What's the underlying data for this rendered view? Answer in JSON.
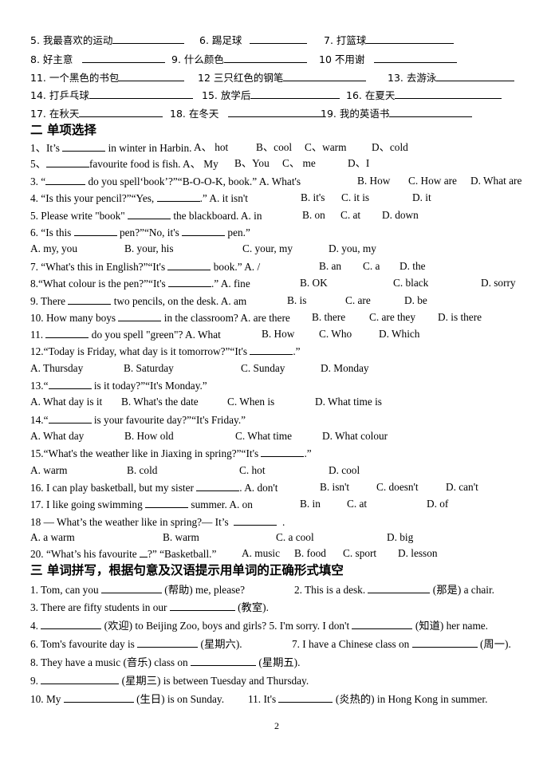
{
  "vocab": {
    "row1": [
      "5.  我最喜欢的运动",
      "6.  踢足球",
      "7.  打篮球"
    ],
    "row2": [
      "8.  好主意",
      "9.  什么颜色",
      "10  不用谢"
    ],
    "row3": [
      "11.  一个黑色的书包",
      "12  三只红色的钢笔",
      "13.  去游泳"
    ],
    "row4": [
      "14.  打乒乓球",
      "15.  放学后",
      "16.  在夏天"
    ],
    "row5": [
      "17.  在秋天",
      "18.  在冬天",
      "19.  我的英语书"
    ]
  },
  "section2": {
    "title": "二  单项选择",
    "q1": {
      "stem_a": "1、It’s",
      "stem_b": "in winter in Harbin.",
      "opts": [
        "A、  hot",
        "B、cool",
        "C、warm",
        "D、cold"
      ]
    },
    "q2": {
      "stem_a": "5、",
      "stem_b": "favourite food is fish. A、  My",
      "opts": [
        "B、You",
        "C、   me",
        "D、I"
      ]
    },
    "q3": {
      "stem_a": "3.  “",
      "stem_b": "do you spell‘book’?”“B-O-O-K, book.” A. What's",
      "opts": [
        "B. How",
        "C. How are",
        "D. What are"
      ]
    },
    "q4": {
      "stem_a": "4.  “Is this your pencil?”“Yes,",
      "stem_b": ".” A. it isn't",
      "opts": [
        "B. it's",
        "C. it is",
        "D. it"
      ]
    },
    "q5": {
      "stem_a": "5. Please write \"book\"",
      "stem_b": "the blackboard. A. in",
      "opts": [
        "B. on",
        "C. at",
        "D. down"
      ]
    },
    "q6": {
      "stem_a": "6.  “Is this",
      "stem_b": "pen?”“No, it's",
      "stem_c": "pen.”",
      "opts": [
        "A. my, you",
        "B. your, his",
        "C. your, my",
        "D. you, my"
      ]
    },
    "q7": {
      "stem_a": "7.  “What's this in English?”“It's",
      "stem_b": "book.”  A. /",
      "opts": [
        "B. an",
        "C. a",
        "D. the"
      ]
    },
    "q8": {
      "stem_a": "8.“What colour is the pen?”“It's",
      "stem_b": ".” A. fine",
      "opts": [
        "B. OK",
        "C. black",
        "D. sorry"
      ]
    },
    "q9": {
      "stem_a": "9. There",
      "stem_b": "two pencils, on the desk. A. am",
      "opts": [
        "B. is",
        "C. are",
        "D. be"
      ]
    },
    "q10": {
      "stem_a": "10. How many boys",
      "stem_b": "in the classroom?  A. are there",
      "opts": [
        "B. there",
        "C. are they",
        "D. is there"
      ]
    },
    "q11": {
      "stem_a": "11.",
      "stem_b": "do you spell \"green\"? A. What",
      "opts": [
        "B. How",
        "C. Who",
        "D. Which"
      ]
    },
    "q12": {
      "stem_a": "12.“Today is Friday, what day is it tomorrow?”“It's",
      "stem_b": ".”",
      "opts": [
        "A. Thursday",
        "B. Saturday",
        "C. Sunday",
        "D. Monday"
      ]
    },
    "q13": {
      "stem_a": "13.“",
      "stem_b": "is it today?”“It's Monday.”",
      "opts": [
        "A. What day is it",
        "B. What's the date",
        "C. When is",
        "D. What time is"
      ]
    },
    "q14": {
      "stem_a": "14.“",
      "stem_b": "is your favourite day?”“It's Friday.”",
      "opts": [
        "A. What day",
        "B. How old",
        "C. What time",
        "D. What colour"
      ]
    },
    "q15": {
      "stem_a": "15.“What's the weather like in Jiaxing in spring?”“It's",
      "stem_b": ".”",
      "opts": [
        "A. warm",
        "B. cold",
        "C. hot",
        "D. cool"
      ]
    },
    "q16": {
      "stem_a": "16. I can play basketball, but my sister",
      "stem_b": ". A. don't",
      "opts": [
        "B. isn't",
        "C. doesn't",
        "D. can't"
      ]
    },
    "q17": {
      "stem_a": "17. I like going swimming",
      "stem_b": "summer. A. on",
      "opts": [
        "B. in",
        "C. at",
        "D. of"
      ]
    },
    "q18": {
      "stem_a": "18 — What’s the weather like in spring?— It’s",
      "stem_b": ".",
      "opts": [
        "A. a warm",
        "B. warm",
        "C. a cool",
        "D. big"
      ]
    },
    "q20": {
      "stem_a": "20. “What’s his favourite",
      "stem_b": "?” “Basketball.”",
      "opts": [
        "A. music",
        "B. food",
        "C. sport",
        "D. lesson"
      ]
    }
  },
  "section3": {
    "title": "三  单词拼写，根据句意及汉语提示用单词的正确形式填空",
    "l1": {
      "a": "1. Tom, can you",
      "b": "(帮助) me, please?",
      "c": "2. This is a desk.",
      "d": "(那是) a chair."
    },
    "l2": {
      "a": "3. There are fifty students in our",
      "b": "(教室)."
    },
    "l3": {
      "a": "4.",
      "b": "(欢迎) to Beijing Zoo, boys and girls? 5. I'm sorry. I don't",
      "c": "(知道) her name."
    },
    "l4": {
      "a": "6. Tom's favourite day is",
      "b": "(星期六).",
      "c": "7. I have a Chinese class on",
      "d": "(周一)."
    },
    "l5": {
      "a": "8. They have a music (音乐) class on",
      "b": "(星期五)."
    },
    "l6": {
      "a": "9.",
      "b": "(星期三) is between Tuesday and Thursday."
    },
    "l7": {
      "a": "10. My",
      "b": "(生日) is on Sunday.",
      "c": "11. It's",
      "d": "(炎热的) in Hong Kong in summer."
    }
  },
  "footer": {
    "page_number": "2"
  }
}
